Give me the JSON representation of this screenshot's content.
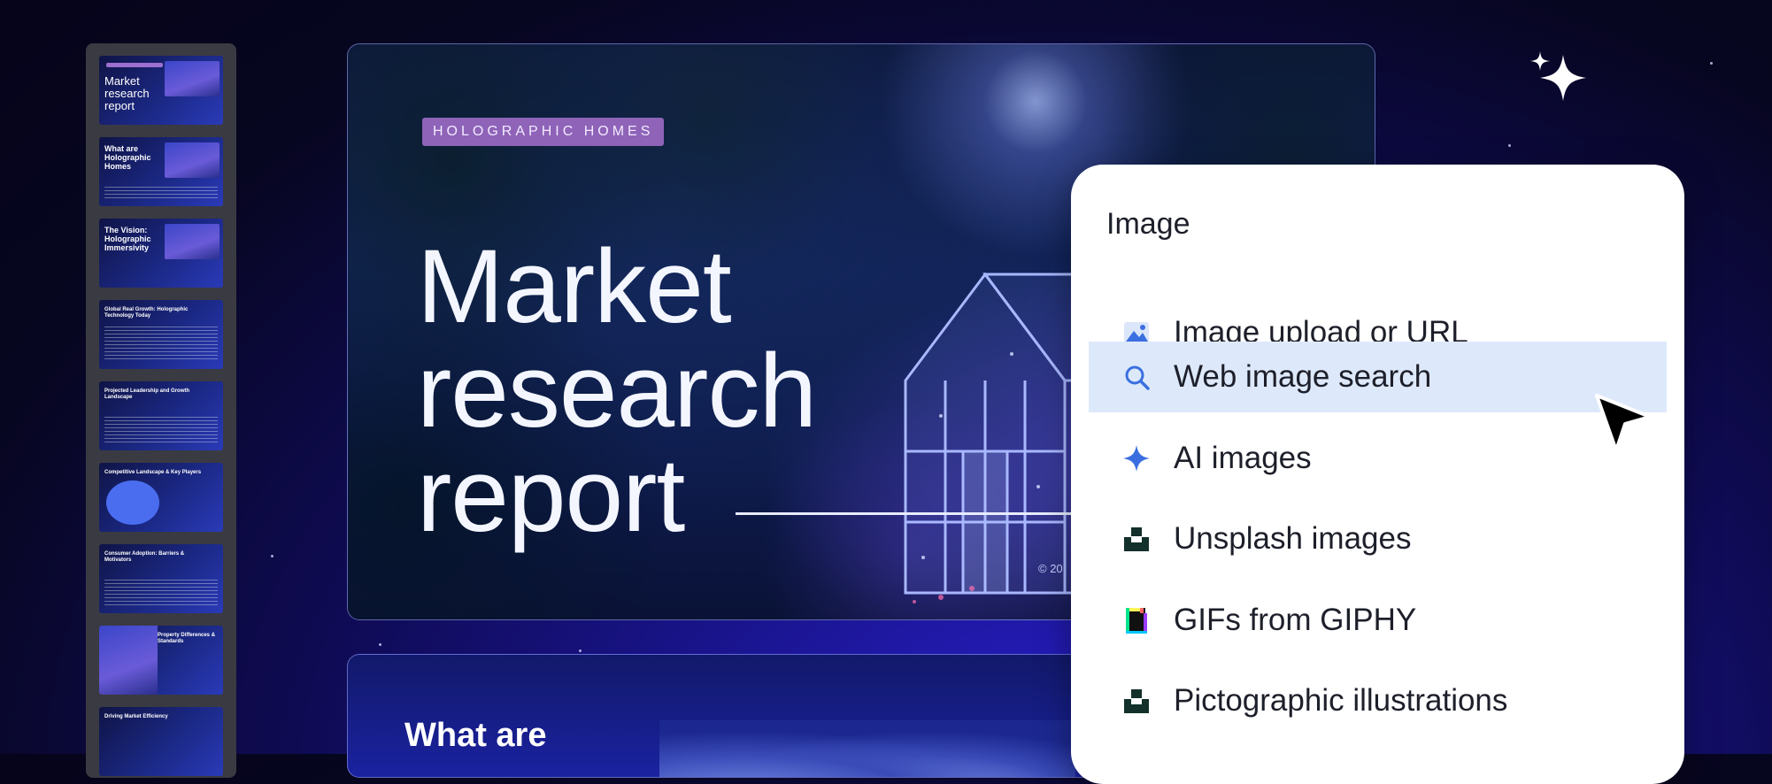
{
  "thumbnails": [
    {
      "title": "Market research report"
    },
    {
      "title": "What are Holographic Homes"
    },
    {
      "title": "The Vision: Holographic Immersivity"
    },
    {
      "title": "Global Real Growth: Holographic Technology Today"
    },
    {
      "title": "Projected Leadership and Growth Landscape"
    },
    {
      "title": "Competitive Landscape & Key Players"
    },
    {
      "title": "Consumer Adoption: Barriers & Motivators"
    },
    {
      "title": "Property Differences & Standards"
    },
    {
      "title": "Driving Market Efficiency"
    }
  ],
  "slide": {
    "tag": "HOLOGRAPHIC HOMES",
    "title_line1": "Market",
    "title_line2": "research",
    "title_line3": "report",
    "footer": "© 20"
  },
  "slide2": {
    "title": "What are"
  },
  "menu": {
    "title": "Image",
    "items": [
      {
        "label": "Image upload or URL",
        "icon": "image-icon"
      },
      {
        "label": "Web image search",
        "icon": "search-icon",
        "active": true
      },
      {
        "label": "AI images",
        "icon": "sparkle-icon"
      },
      {
        "label": "Unsplash images",
        "icon": "unsplash-icon"
      },
      {
        "label": "GIFs from GIPHY",
        "icon": "giphy-icon"
      },
      {
        "label": "Pictographic illustrations",
        "icon": "pictographic-icon"
      }
    ]
  },
  "colors": {
    "accent": "#3b6fe0",
    "active_row": "#dde9fb",
    "tag_bg": "#8e63b8"
  }
}
